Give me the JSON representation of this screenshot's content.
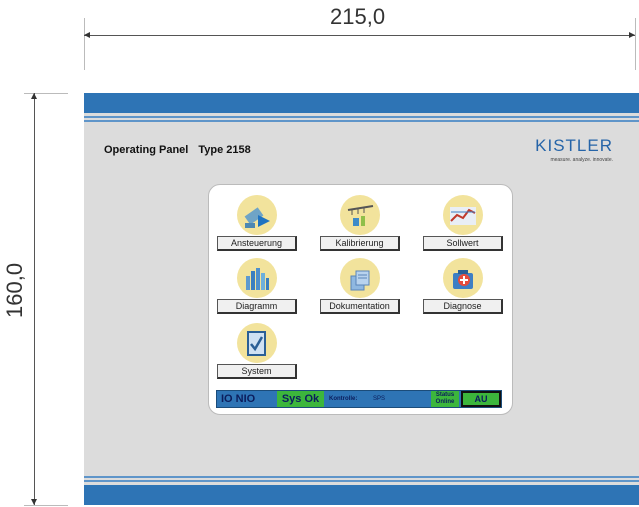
{
  "dimensions": {
    "width_label": "215,0",
    "height_label": "160,0"
  },
  "header": {
    "title": "Operating Panel",
    "type": "Type 2158"
  },
  "logo": {
    "brand": "KISTLER",
    "tagline": "measure. analyze. innovate."
  },
  "menu": {
    "items": [
      {
        "label": "Ansteuerung",
        "icon": "control-icon"
      },
      {
        "label": "Kalibrierung",
        "icon": "calibration-icon"
      },
      {
        "label": "Sollwert",
        "icon": "setpoint-icon"
      },
      {
        "label": "Diagramm",
        "icon": "diagram-icon"
      },
      {
        "label": "Dokumentation",
        "icon": "documentation-icon"
      },
      {
        "label": "Diagnose",
        "icon": "diagnose-icon"
      },
      {
        "label": "System",
        "icon": "system-icon"
      }
    ]
  },
  "statusbar": {
    "io": "IO NIO",
    "sys": "Sys Ok",
    "kontrolle_label": "Kontrolle:",
    "kontrolle_value": "SPS",
    "status_label": "Status",
    "status_value": "Online",
    "mode": "AU"
  },
  "colors": {
    "band_blue": "#2e74b5",
    "panel_gray": "#dcdcdc",
    "status_green": "#3cb63c",
    "icon_bg": "#f2e39c"
  }
}
